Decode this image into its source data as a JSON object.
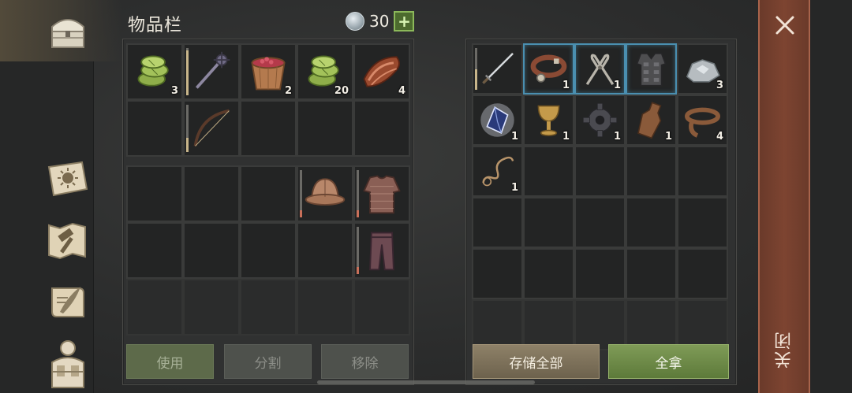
{
  "header": {
    "title": "物品栏",
    "currency_value": "30",
    "add_label": "+"
  },
  "nav": {
    "items": [
      {
        "name": "chest-icon"
      },
      {
        "name": "sun-book-icon"
      },
      {
        "name": "map-hammer-icon"
      },
      {
        "name": "scroll-quill-icon"
      },
      {
        "name": "character-icon"
      }
    ]
  },
  "left_panel": {
    "top_grid": [
      {
        "icon": "food-bundle",
        "count": "3"
      },
      {
        "icon": "mace",
        "count": "",
        "durability": 0.95,
        "dcolor": "#c8b58a"
      },
      {
        "icon": "berry-bucket",
        "count": "2"
      },
      {
        "icon": "food-bundle",
        "count": "20"
      },
      {
        "icon": "meat",
        "count": "4"
      },
      {
        "icon": "",
        "count": ""
      },
      {
        "icon": "bow",
        "count": "",
        "durability": 0.3,
        "dcolor": "#c8b58a"
      },
      {
        "icon": "",
        "count": ""
      },
      {
        "icon": "",
        "count": ""
      },
      {
        "icon": "",
        "count": ""
      }
    ],
    "equip_grid": [
      {
        "icon": ""
      },
      {
        "icon": ""
      },
      {
        "icon": ""
      },
      {
        "icon": "helmet",
        "durability": 0.15,
        "dcolor": "#c9705a"
      },
      {
        "icon": "chainmail",
        "durability": 0.15,
        "dcolor": "#c9705a"
      },
      {
        "icon": ""
      },
      {
        "icon": ""
      },
      {
        "icon": ""
      },
      {
        "icon": ""
      },
      {
        "icon": "pants",
        "durability": 0.15,
        "dcolor": "#c9705a"
      },
      {
        "icon": "",
        "dim": true
      },
      {
        "icon": "",
        "dim": true
      },
      {
        "icon": "",
        "dim": true
      },
      {
        "icon": "",
        "dim": true
      },
      {
        "icon": "",
        "dim": true
      }
    ]
  },
  "right_panel": {
    "grid": [
      {
        "icon": "sword",
        "count": "",
        "durability": 0.5,
        "dcolor": "#c8b58a"
      },
      {
        "icon": "collar",
        "count": "1",
        "selected": true
      },
      {
        "icon": "pliers",
        "count": "1",
        "selected": true
      },
      {
        "icon": "armor-vest",
        "count": "",
        "selected": true
      },
      {
        "icon": "silver-ore",
        "count": "3"
      },
      {
        "icon": "crystal",
        "count": "1"
      },
      {
        "icon": "goblet",
        "count": "1"
      },
      {
        "icon": "gear",
        "count": "1"
      },
      {
        "icon": "bottle",
        "count": "1"
      },
      {
        "icon": "leather-strap",
        "count": "4"
      },
      {
        "icon": "rope",
        "count": "1"
      },
      {
        "icon": "",
        "count": ""
      },
      {
        "icon": "",
        "count": ""
      },
      {
        "icon": "",
        "count": ""
      },
      {
        "icon": "",
        "count": ""
      },
      {
        "icon": "",
        "count": ""
      },
      {
        "icon": "",
        "count": ""
      },
      {
        "icon": "",
        "count": ""
      },
      {
        "icon": "",
        "count": ""
      },
      {
        "icon": "",
        "count": ""
      },
      {
        "icon": "",
        "count": ""
      },
      {
        "icon": "",
        "count": ""
      },
      {
        "icon": "",
        "count": ""
      },
      {
        "icon": "",
        "count": ""
      },
      {
        "icon": "",
        "count": ""
      },
      {
        "icon": "",
        "count": "",
        "dim": true
      },
      {
        "icon": "",
        "count": "",
        "dim": true
      },
      {
        "icon": "",
        "count": "",
        "dim": true
      },
      {
        "icon": "",
        "count": "",
        "dim": true
      },
      {
        "icon": "",
        "count": "",
        "dim": true
      }
    ]
  },
  "buttons": {
    "use": "使用",
    "split": "分割",
    "remove": "移除",
    "store_all": "存储全部",
    "take_all": "全拿"
  },
  "close": {
    "label": "关闭"
  }
}
